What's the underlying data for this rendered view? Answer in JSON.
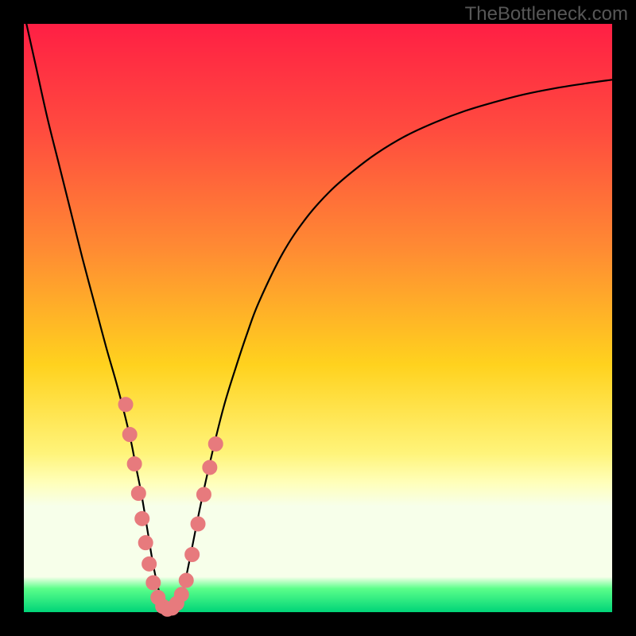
{
  "watermark": "TheBottleneck.com",
  "gradient_stops": [
    {
      "offset": 0,
      "color": "#ff1f44"
    },
    {
      "offset": 18,
      "color": "#ff4b3f"
    },
    {
      "offset": 38,
      "color": "#ff8a33"
    },
    {
      "offset": 58,
      "color": "#ffd21e"
    },
    {
      "offset": 73,
      "color": "#fff47a"
    },
    {
      "offset": 78,
      "color": "#ffffba"
    },
    {
      "offset": 82,
      "color": "#f7ffea"
    },
    {
      "offset": 94,
      "color": "#f7ffea"
    },
    {
      "offset": 96,
      "color": "#5bff8a"
    },
    {
      "offset": 100,
      "color": "#00d478"
    }
  ],
  "curve_stroke": "#000000",
  "curve_width": 2.2,
  "marker_fill": "#e77a7d",
  "marker_stroke": "#e77a7d",
  "marker_radius": 9,
  "chart_data": {
    "type": "line",
    "title": "",
    "xlabel": "",
    "ylabel": "",
    "xlim": [
      0,
      100
    ],
    "ylim": [
      0,
      100
    ],
    "series": [
      {
        "name": "bottleneck-curve",
        "x": [
          0,
          2,
          4,
          6,
          8,
          10,
          12,
          14,
          16,
          18,
          19,
          20,
          21,
          22,
          23,
          24,
          25,
          26,
          27,
          28,
          30,
          32,
          34,
          36,
          38,
          40,
          44,
          48,
          52,
          56,
          60,
          65,
          70,
          75,
          80,
          85,
          90,
          95,
          100
        ],
        "y": [
          102,
          93,
          84,
          76,
          68,
          60,
          52.5,
          45,
          38,
          30,
          25,
          20,
          14,
          8,
          3.5,
          1.2,
          0.5,
          1.2,
          3.5,
          8,
          18,
          27,
          35,
          41.5,
          47.5,
          52.8,
          61,
          67,
          71.5,
          75,
          78,
          81,
          83.3,
          85.2,
          86.7,
          88,
          89,
          89.8,
          90.5
        ]
      }
    ],
    "markers": {
      "name": "highlighted-points",
      "x": [
        17.3,
        18.0,
        18.8,
        19.5,
        20.1,
        20.7,
        21.3,
        22.0,
        22.8,
        23.6,
        24.4,
        25.2,
        26.0,
        26.8,
        27.6,
        28.6,
        29.6,
        30.6,
        31.6,
        32.6
      ],
      "y": [
        35.3,
        30.2,
        25.2,
        20.2,
        15.9,
        11.8,
        8.2,
        5.0,
        2.5,
        1.0,
        0.5,
        0.7,
        1.5,
        3.0,
        5.4,
        9.8,
        15.0,
        20.0,
        24.6,
        28.6
      ]
    }
  }
}
